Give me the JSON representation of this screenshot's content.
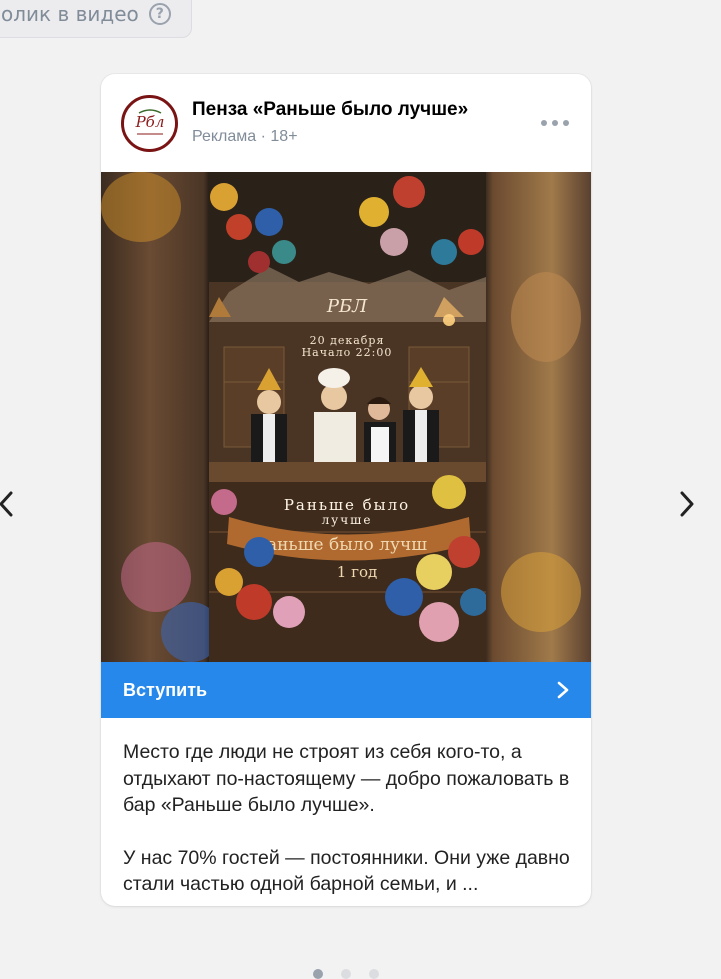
{
  "top_chip": {
    "label": "олик в видео"
  },
  "post": {
    "author": "Пенза «Раньше было лучше»",
    "meta": "Реклама · 18+",
    "cta_label": "Вступить",
    "text_paragraph_1": "Место где люди не строят из себя кого-то, а отдыхают по-настоящему — добро пожаловать в бар «Раньше было лучше».",
    "text_paragraph_2": "У нас 70% гостей — постоянники. Они уже давно стали частью одной барной семьи, и ...",
    "video_overlay": {
      "logo": "РБЛ",
      "date_line": "20 декабря",
      "time_line": "Начало 22:00",
      "neon_line_1": "Раньше было",
      "neon_line_2": "лучше",
      "banner": "аньше было лучш",
      "banner_2": "1 год"
    }
  },
  "pagination": {
    "count": 3,
    "active": 1
  },
  "colors": {
    "accent": "#2688eb",
    "background": "#f2f2f3",
    "muted": "#818c99"
  }
}
